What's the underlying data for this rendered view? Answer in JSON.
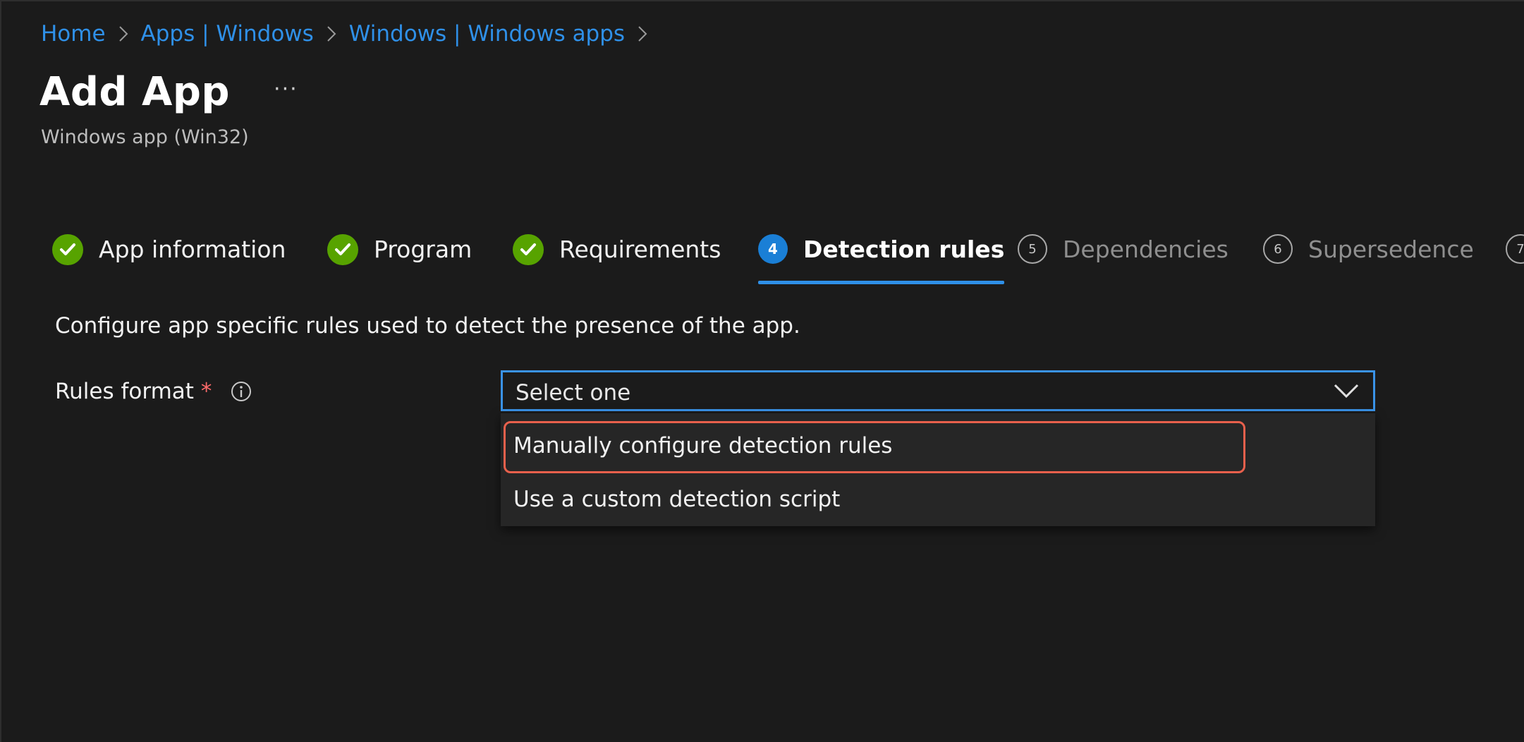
{
  "breadcrumb": {
    "items": [
      "Home",
      "Apps | Windows",
      "Windows | Windows apps"
    ]
  },
  "header": {
    "title": "Add App",
    "more_label": "···",
    "subtitle": "Windows app (Win32)"
  },
  "steps": [
    {
      "label": "App information",
      "status": "complete"
    },
    {
      "label": "Program",
      "status": "complete"
    },
    {
      "label": "Requirements",
      "status": "complete"
    },
    {
      "label": "Detection rules",
      "status": "active",
      "number": "4"
    },
    {
      "label": "Dependencies",
      "status": "pending",
      "number": "5"
    },
    {
      "label": "Supersedence",
      "status": "pending",
      "number": "6"
    },
    {
      "label": "",
      "status": "pending",
      "number": "7"
    }
  ],
  "content": {
    "description": "Configure app specific rules used to detect the presence of the app.",
    "rules_format": {
      "label": "Rules format",
      "required_marker": "*",
      "value": "Select one",
      "options": [
        "Manually configure detection rules",
        "Use a custom detection script"
      ]
    }
  },
  "colors": {
    "background": "#1b1b1b",
    "link": "#2f90e8",
    "accent": "#1a7fd6",
    "complete": "#57a300",
    "highlight": "#e8604c",
    "required": "#ff6b6b"
  },
  "icons": {
    "complete": "checkmark-icon",
    "info": "info-icon",
    "dropdown": "chevron-down-icon",
    "breadcrumb_separator": "chevron-right-icon"
  }
}
